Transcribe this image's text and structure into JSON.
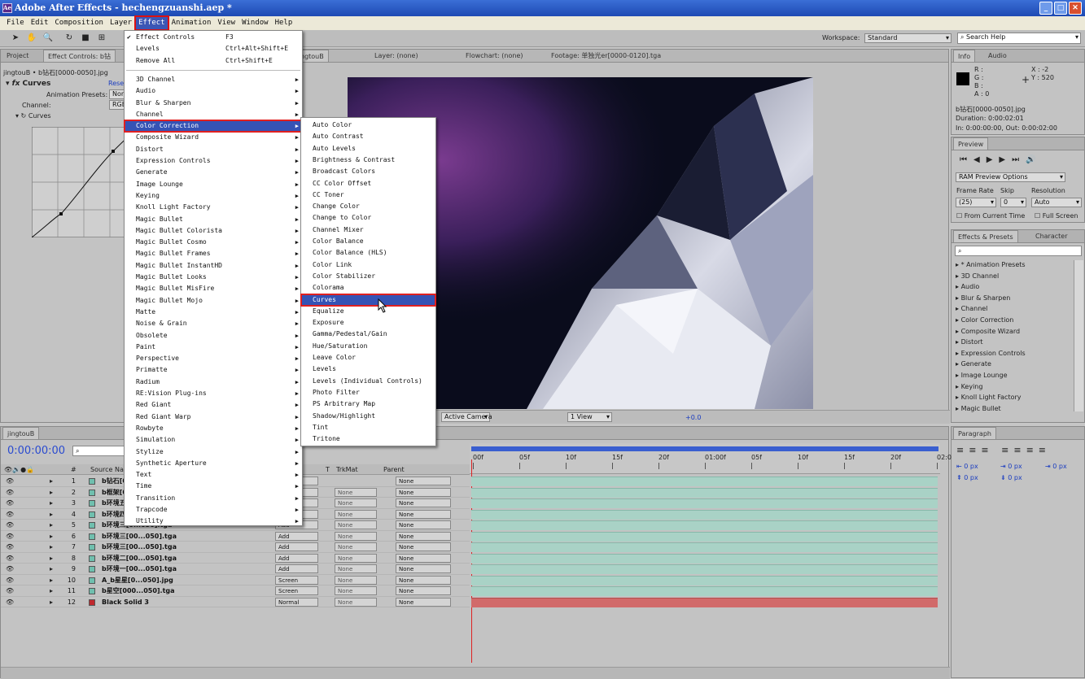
{
  "window": {
    "title": "Adobe After Effects - hechengzuanshi.aep *",
    "app_icon": "Ae"
  },
  "menubar": [
    "File",
    "Edit",
    "Composition",
    "Layer",
    "Effect",
    "Animation",
    "View",
    "Window",
    "Help"
  ],
  "workspace": {
    "label": "Workspace:",
    "value": "Standard"
  },
  "search_help": "Search Help",
  "effect_menu": {
    "top": [
      {
        "label": "Effect Controls",
        "shortcut": "F3",
        "checked": true
      },
      {
        "label": "Levels",
        "shortcut": "Ctrl+Alt+Shift+E"
      },
      {
        "label": "Remove All",
        "shortcut": "Ctrl+Shift+E"
      }
    ],
    "categories": [
      "3D Channel",
      "Audio",
      "Blur & Sharpen",
      "Channel",
      "Color Correction",
      "Composite Wizard",
      "Distort",
      "Expression Controls",
      "Generate",
      "Image Lounge",
      "Keying",
      "Knoll Light Factory",
      "Magic Bullet",
      "Magic Bullet Colorista",
      "Magic Bullet Cosmo",
      "Magic Bullet Frames",
      "Magic Bullet InstantHD",
      "Magic Bullet Looks",
      "Magic Bullet MisFire",
      "Magic Bullet Mojo",
      "Matte",
      "Noise & Grain",
      "Obsolete",
      "Paint",
      "Perspective",
      "Primatte",
      "Radium",
      "RE:Vision Plug-ins",
      "Red Giant",
      "Red Giant Warp",
      "Rowbyte",
      "Simulation",
      "Stylize",
      "Synthetic Aperture",
      "Text",
      "Time",
      "Transition",
      "Trapcode",
      "Utility"
    ],
    "highlighted": "Color Correction"
  },
  "color_correction_menu": {
    "items": [
      "Auto Color",
      "Auto Contrast",
      "Auto Levels",
      "Brightness & Contrast",
      "Broadcast Colors",
      "CC Color Offset",
      "CC Toner",
      "Change Color",
      "Change to Color",
      "Channel Mixer",
      "Color Balance",
      "Color Balance (HLS)",
      "Color Link",
      "Color Stabilizer",
      "Colorama",
      "Curves",
      "Equalize",
      "Exposure",
      "Gamma/Pedestal/Gain",
      "Hue/Saturation",
      "Leave Color",
      "Levels",
      "Levels (Individual Controls)",
      "Photo Filter",
      "PS Arbitrary Map",
      "Shadow/Highlight",
      "Tint",
      "Tritone"
    ],
    "highlighted": "Curves"
  },
  "left_panel": {
    "tabs": [
      "Project",
      "Effect Controls: b钻"
    ],
    "breadcrumb": "jingtouB • b钻石[0000-0050].jpg",
    "effect_name": "Curves",
    "reset": "Reset",
    "animation_presets": "Animation Presets:",
    "anim_value": "Non",
    "channel_label": "Channel:",
    "channel_value": "RGB",
    "curves_label": "Curves"
  },
  "viewer": {
    "tabs": [
      "ngtouB",
      "Layer: (none)",
      "Flowchart: (none)",
      "Footage: 单独光er[0000-0120].tga"
    ],
    "camera": "Active Camera",
    "views": "1 View",
    "exposure": "+0.0"
  },
  "info_panel": {
    "tabs": [
      "Info",
      "Audio"
    ],
    "r": "R :",
    "g": "G :",
    "b": "B :",
    "a": "A : 0",
    "x": "X : -2",
    "y": "Y : 520",
    "file": "b钻石[0000-0050].jpg",
    "duration": "Duration: 0:00:02:01",
    "inout": "In: 0:00:00:00, Out: 0:00:02:00"
  },
  "preview_panel": {
    "tab": "Preview",
    "ram": "RAM Preview Options",
    "frame_rate": "Frame Rate",
    "skip": "Skip",
    "resolution": "Resolution",
    "fr_value": "(25)",
    "skip_value": "0",
    "res_value": "Auto",
    "from_current": "From Current Time",
    "full_screen": "Full Screen"
  },
  "effects_presets": {
    "tabs": [
      "Effects & Presets",
      "Character"
    ],
    "items": [
      "* Animation Presets",
      "3D Channel",
      "Audio",
      "Blur & Sharpen",
      "Channel",
      "Color Correction",
      "Composite Wizard",
      "Distort",
      "Expression Controls",
      "Generate",
      "Image Lounge",
      "Keying",
      "Knoll Light Factory",
      "Magic Bullet"
    ]
  },
  "paragraph_panel": {
    "tab": "Paragraph",
    "values": [
      "0 px",
      "0 px",
      "0 px",
      "0 px",
      "0 px"
    ]
  },
  "timeline": {
    "tab": "jingtouB",
    "timecode": "0:00:00:00",
    "cols": {
      "hash": "#",
      "source": "Source Name",
      "t": "T",
      "trkmat": "TrkMat",
      "parent": "Parent"
    },
    "ruler": [
      "00f",
      "05f",
      "10f",
      "15f",
      "20f",
      "01:00f",
      "05f",
      "10f",
      "15f",
      "20f",
      "02:0"
    ],
    "layers": [
      {
        "n": "1",
        "name": "b钻石[0000-0050].jpg",
        "mode": "Normal",
        "trk": "",
        "parent": "None",
        "color": "#6fbfae"
      },
      {
        "n": "2",
        "name": "b框架[0000-0050].tga",
        "mode": "Normal",
        "trk": "None",
        "parent": "None",
        "color": "#6fbfae"
      },
      {
        "n": "3",
        "name": "b环境五[0...050].tga",
        "mode": "Add",
        "trk": "None",
        "parent": "None",
        "color": "#6fbfae"
      },
      {
        "n": "4",
        "name": "b环境四[0...050].tga",
        "mode": "Add",
        "trk": "None",
        "parent": "None",
        "color": "#6fbfae"
      },
      {
        "n": "5",
        "name": "b环境三[0...050].tga",
        "mode": "Add",
        "trk": "None",
        "parent": "None",
        "color": "#6fbfae"
      },
      {
        "n": "6",
        "name": "b环境三[00...050].tga",
        "mode": "Add",
        "trk": "None",
        "parent": "None",
        "color": "#6fbfae"
      },
      {
        "n": "7",
        "name": "b环境三[00...050].tga",
        "mode": "Add",
        "trk": "None",
        "parent": "None",
        "color": "#6fbfae"
      },
      {
        "n": "8",
        "name": "b环境二[00...050].tga",
        "mode": "Add",
        "trk": "None",
        "parent": "None",
        "color": "#6fbfae"
      },
      {
        "n": "9",
        "name": "b环境一[00...050].tga",
        "mode": "Add",
        "trk": "None",
        "parent": "None",
        "color": "#6fbfae"
      },
      {
        "n": "10",
        "name": "A_b星星[0...050].jpg",
        "mode": "Screen",
        "trk": "None",
        "parent": "None",
        "color": "#6fbfae"
      },
      {
        "n": "11",
        "name": "b星空[000...050].tga",
        "mode": "Screen",
        "trk": "None",
        "parent": "None",
        "color": "#6fbfae"
      },
      {
        "n": "12",
        "name": "Black Solid 3",
        "mode": "Normal",
        "trk": "None",
        "parent": "None",
        "color": "#c0282d"
      }
    ]
  },
  "colors": {
    "menu_highlight": "#3553b5",
    "red_outline": "#e02020",
    "bar": "#a9d2c6",
    "solid_bar": "#d16a6a"
  }
}
